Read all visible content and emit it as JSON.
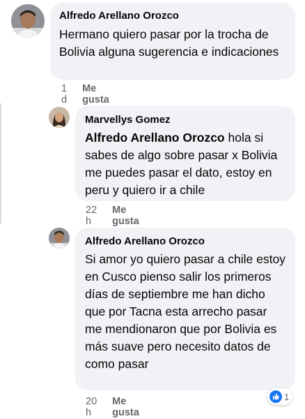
{
  "comments": [
    {
      "author": "Alfredo Arellano Orozco",
      "text": "Hermano quiero pasar por la trocha de Bolivia alguna sugerencia e indicaciones",
      "time": "1 d",
      "like_label": "Me gusta"
    },
    {
      "author": "Marvellys Gomez",
      "mention": "Alfredo Arellano Orozco",
      "text": " hola si sabes de algo sobre pasar x Bolivia me puedes pasar el dato, estoy en peru y quiero ir a chile",
      "time": "22 h",
      "like_label": "Me gusta"
    },
    {
      "author": "Alfredo Arellano Orozco",
      "text": "Si amor yo quiero pasar a chile estoy en Cusco pienso salir los primeros días de septiembre me han dicho que por Tacna esta arrecho pasar me mendionaron que por Bolivia es más suave pero necesito datos de como pasar",
      "time": "20 h",
      "like_label": "Me gusta",
      "reaction_count": "1",
      "reaction_icon": "like-thumb-icon",
      "reaction_color": "#1877f2"
    }
  ]
}
